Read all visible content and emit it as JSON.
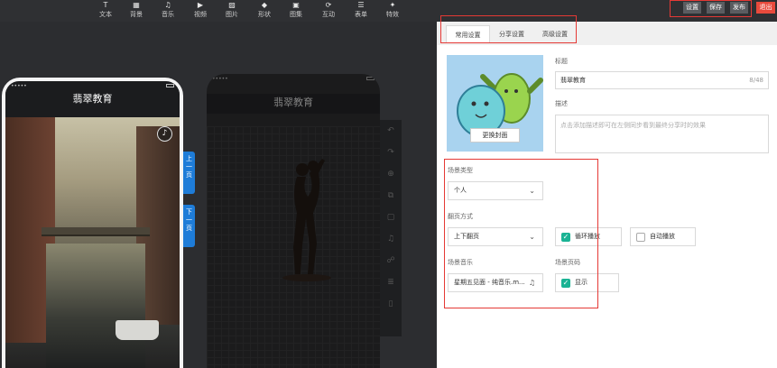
{
  "toolbar": {
    "items": [
      {
        "label": "文本",
        "icon": "T"
      },
      {
        "label": "背景",
        "icon": "▦"
      },
      {
        "label": "音乐",
        "icon": "♫"
      },
      {
        "label": "视频",
        "icon": "▶"
      },
      {
        "label": "图片",
        "icon": "▨"
      },
      {
        "label": "形状",
        "icon": "◆"
      },
      {
        "label": "图集",
        "icon": "▣"
      },
      {
        "label": "互动",
        "icon": "⟳"
      },
      {
        "label": "表单",
        "icon": "☰"
      },
      {
        "label": "特效",
        "icon": "✦"
      }
    ],
    "buttons": {
      "settings": "设置",
      "save": "保存",
      "publish": "发布",
      "exit": "退出"
    }
  },
  "phone": {
    "status_dots": "•••••",
    "title": "翡翠教育",
    "music_icon": "♪",
    "page_up": "上一页",
    "page_down": "下一页"
  },
  "ghost_phone": {
    "status_dots": "•••••",
    "title": "翡翠教育"
  },
  "vtoolbar": {
    "icons": [
      "↶",
      "↷",
      "⊕",
      "⧉",
      "▢",
      "♫",
      "☍",
      "≣",
      "▯"
    ]
  },
  "panel": {
    "tabs": [
      "常用设置",
      "分享设置",
      "高级设置"
    ],
    "active_tab": 0,
    "cover_button": "更换封面",
    "title_label": "标题",
    "title_value": "翡翠教育",
    "title_counter": "8/48",
    "desc_label": "描述",
    "desc_placeholder": "点击添加描述即可在左侧同步看到最终分享时的效果",
    "scene_type_label": "场景类型",
    "scene_type_value": "个人",
    "page_mode_label": "翻页方式",
    "page_mode_value": "上下翻页",
    "loop_label": "循环播放",
    "loop_checked": true,
    "autoplay_label": "自动播放",
    "autoplay_checked": false,
    "music_label": "场景音乐",
    "music_value": "星期五见面 - 纯音乐.m...",
    "music_icon": "♫",
    "page_number_label": "场景页码",
    "page_number_value": "显示",
    "page_number_checked": true
  },
  "colors": {
    "accent": "#1ab394",
    "highlight": "#e53935",
    "exit": "#e84a3c",
    "page_button": "#1e7cd8"
  }
}
